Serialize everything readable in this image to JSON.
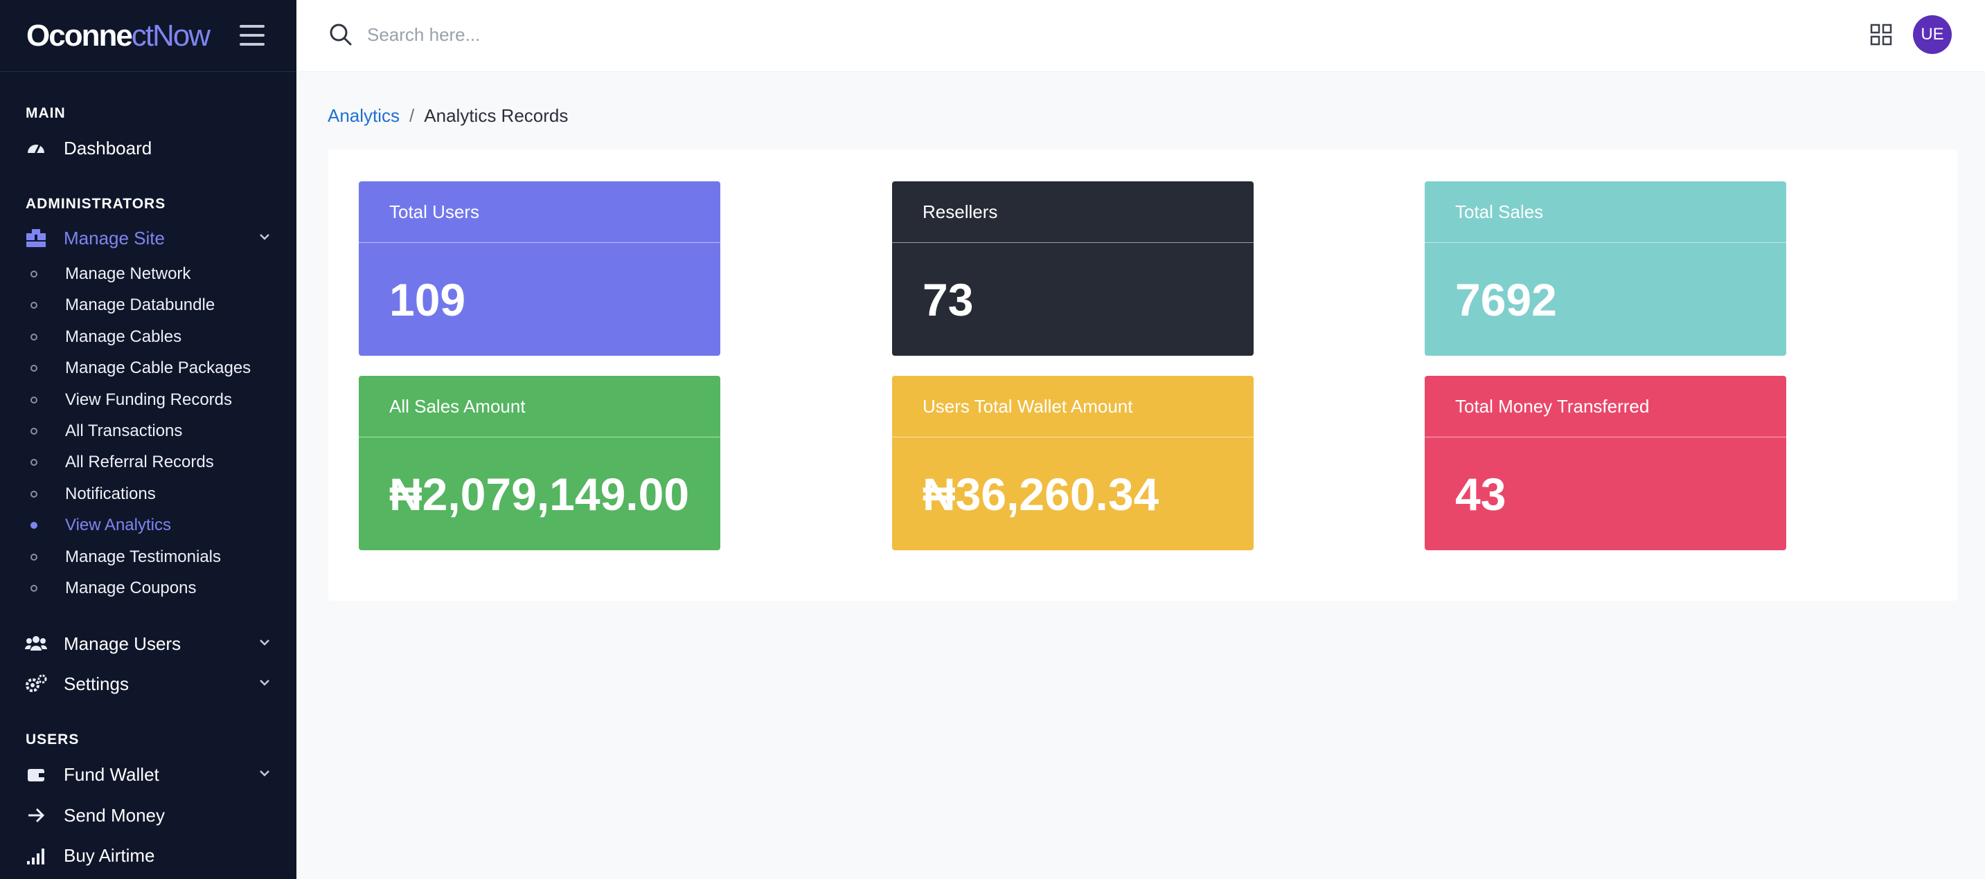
{
  "brand": {
    "name_main": "Oconne",
    "name_accent": "ctNow"
  },
  "sidebar": {
    "sections": {
      "main": "MAIN",
      "administrators": "ADMINISTRATORS",
      "users": "USERS"
    },
    "dashboard": "Dashboard",
    "manage_site": "Manage Site",
    "manage_site_items": [
      "Manage Network",
      "Manage Databundle",
      "Manage Cables",
      "Manage Cable Packages",
      "View Funding Records",
      "All Transactions",
      "All Referral Records",
      "Notifications",
      "View Analytics",
      "Manage Testimonials",
      "Manage Coupons"
    ],
    "manage_users": "Manage Users",
    "settings": "Settings",
    "fund_wallet": "Fund Wallet",
    "send_money": "Send Money",
    "buy_airtime": "Buy Airtime"
  },
  "header": {
    "search_placeholder": "Search here...",
    "avatar_initials": "UE"
  },
  "breadcrumb": {
    "parent": "Analytics",
    "separator": "/",
    "current": "Analytics Records"
  },
  "cards": [
    {
      "title": "Total Users",
      "value": "109",
      "color": "#7177eb"
    },
    {
      "title": "Resellers",
      "value": "73",
      "color": "#272b35"
    },
    {
      "title": "Total Sales",
      "value": "7692",
      "color": "#7fcfcd"
    },
    {
      "title": "All Sales Amount",
      "value": "₦2,079,149.00",
      "color": "#55b560"
    },
    {
      "title": "Users Total Wallet Amount",
      "value": "₦36,260.34",
      "color": "#f0bd41"
    },
    {
      "title": "Total Money Transferred",
      "value": "43",
      "color": "#e9476a"
    }
  ],
  "colors": {
    "sidebar_bg": "#0f1629",
    "accent": "#7f85f0",
    "link": "#1f6fd1"
  }
}
